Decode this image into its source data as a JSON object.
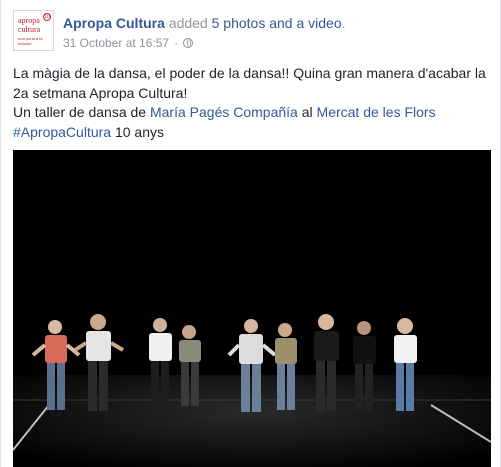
{
  "post": {
    "page_name": "Apropa Cultura",
    "action_text": "added",
    "media_link": "5 photos and a video",
    "period": ".",
    "timestamp": "31 October at 16:57",
    "separator": "·",
    "privacy_icon": "globe-icon"
  },
  "avatar": {
    "logo_line1": "apropa",
    "logo_line2": "cultura",
    "logo_line3": "una porta a la inclusió",
    "logo_badge": "10"
  },
  "message": {
    "line1": "La màgia de la dansa, el poder de la dansa!! Quina gran manera d'acabar la 2a setmana Apropa Cultura!",
    "line2_prefix": "Un taller de dansa de ",
    "line2_link1": "María Pagés Compañía",
    "line2_mid": " al ",
    "line2_link2": "Mercat de les Flors",
    "hashtag": "#ApropaCultura",
    "hashtag_suffix": " 10 anys"
  },
  "colors": {
    "link": "#365899",
    "muted": "#90949c",
    "text": "#1d2129",
    "brand_red": "#c8202f",
    "video_bg": "#000000"
  }
}
